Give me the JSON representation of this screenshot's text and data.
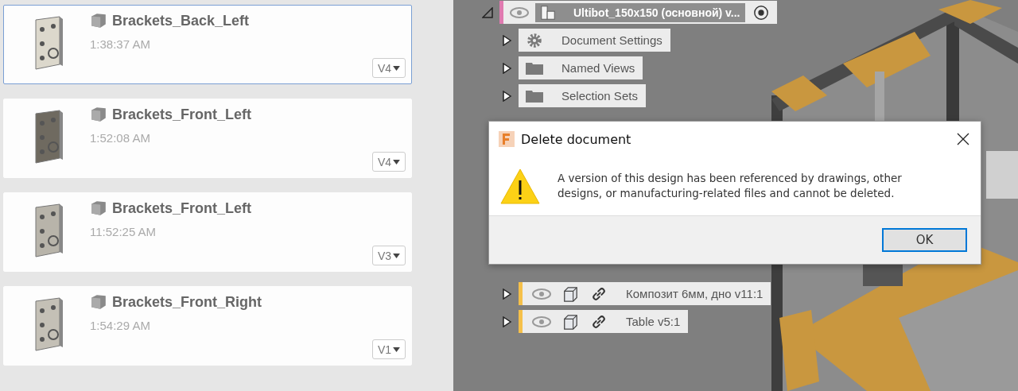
{
  "documents": [
    {
      "name": "Brackets_Back_Left",
      "time": "1:38:37 AM",
      "version": "V4",
      "selected": true
    },
    {
      "name": "Brackets_Front_Left",
      "time": "1:52:08 AM",
      "version": "V4",
      "selected": false
    },
    {
      "name": "Brackets_Front_Left",
      "time": "11:52:25 AM",
      "version": "V3",
      "selected": false
    },
    {
      "name": "Brackets_Front_Right",
      "time": "1:54:29 AM",
      "version": "V1",
      "selected": false
    }
  ],
  "browser": {
    "root": {
      "label": "Ultibot_150x150 (основной) v...",
      "expanded": true,
      "active": true
    },
    "items": [
      {
        "kind": "settings",
        "label": "Document Settings",
        "expanded": false
      },
      {
        "kind": "folder",
        "label": "Named Views",
        "expanded": false
      },
      {
        "kind": "folder",
        "label": "Selection Sets",
        "expanded": false
      }
    ],
    "lower_items": [
      {
        "kind": "component",
        "label": "Композит 6мм, дно v11:1",
        "color": "#f5c04a",
        "linked": true,
        "expanded": false
      },
      {
        "kind": "component",
        "label": "Table v5:1",
        "color": "#f5c04a",
        "linked": true,
        "expanded": false
      }
    ]
  },
  "dialog": {
    "title": "Delete document",
    "message": "A version of this design has been referenced by drawings, other designs, or manufacturing-related files and cannot be deleted.",
    "buttons": [
      "OK"
    ]
  }
}
